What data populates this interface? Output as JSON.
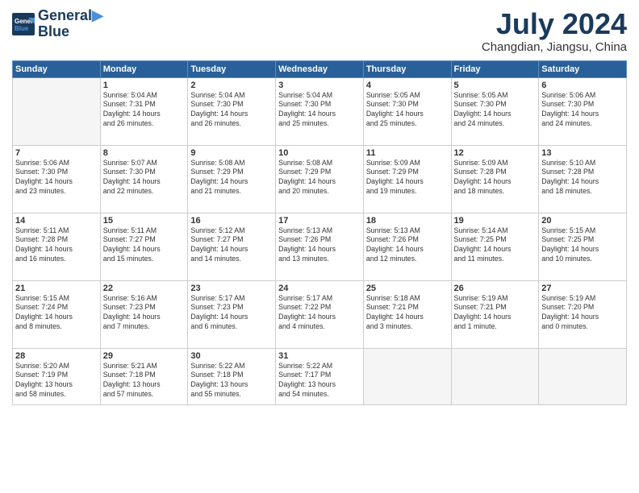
{
  "header": {
    "logo_line1": "General",
    "logo_line2": "Blue",
    "month_year": "July 2024",
    "location": "Changdian, Jiangsu, China"
  },
  "weekdays": [
    "Sunday",
    "Monday",
    "Tuesday",
    "Wednesday",
    "Thursday",
    "Friday",
    "Saturday"
  ],
  "weeks": [
    [
      {
        "day": "",
        "info": ""
      },
      {
        "day": "1",
        "info": "Sunrise: 5:04 AM\nSunset: 7:31 PM\nDaylight: 14 hours\nand 26 minutes."
      },
      {
        "day": "2",
        "info": "Sunrise: 5:04 AM\nSunset: 7:30 PM\nDaylight: 14 hours\nand 26 minutes."
      },
      {
        "day": "3",
        "info": "Sunrise: 5:04 AM\nSunset: 7:30 PM\nDaylight: 14 hours\nand 25 minutes."
      },
      {
        "day": "4",
        "info": "Sunrise: 5:05 AM\nSunset: 7:30 PM\nDaylight: 14 hours\nand 25 minutes."
      },
      {
        "day": "5",
        "info": "Sunrise: 5:05 AM\nSunset: 7:30 PM\nDaylight: 14 hours\nand 24 minutes."
      },
      {
        "day": "6",
        "info": "Sunrise: 5:06 AM\nSunset: 7:30 PM\nDaylight: 14 hours\nand 24 minutes."
      }
    ],
    [
      {
        "day": "7",
        "info": "Sunrise: 5:06 AM\nSunset: 7:30 PM\nDaylight: 14 hours\nand 23 minutes."
      },
      {
        "day": "8",
        "info": "Sunrise: 5:07 AM\nSunset: 7:30 PM\nDaylight: 14 hours\nand 22 minutes."
      },
      {
        "day": "9",
        "info": "Sunrise: 5:08 AM\nSunset: 7:29 PM\nDaylight: 14 hours\nand 21 minutes."
      },
      {
        "day": "10",
        "info": "Sunrise: 5:08 AM\nSunset: 7:29 PM\nDaylight: 14 hours\nand 20 minutes."
      },
      {
        "day": "11",
        "info": "Sunrise: 5:09 AM\nSunset: 7:29 PM\nDaylight: 14 hours\nand 19 minutes."
      },
      {
        "day": "12",
        "info": "Sunrise: 5:09 AM\nSunset: 7:28 PM\nDaylight: 14 hours\nand 18 minutes."
      },
      {
        "day": "13",
        "info": "Sunrise: 5:10 AM\nSunset: 7:28 PM\nDaylight: 14 hours\nand 18 minutes."
      }
    ],
    [
      {
        "day": "14",
        "info": "Sunrise: 5:11 AM\nSunset: 7:28 PM\nDaylight: 14 hours\nand 16 minutes."
      },
      {
        "day": "15",
        "info": "Sunrise: 5:11 AM\nSunset: 7:27 PM\nDaylight: 14 hours\nand 15 minutes."
      },
      {
        "day": "16",
        "info": "Sunrise: 5:12 AM\nSunset: 7:27 PM\nDaylight: 14 hours\nand 14 minutes."
      },
      {
        "day": "17",
        "info": "Sunrise: 5:13 AM\nSunset: 7:26 PM\nDaylight: 14 hours\nand 13 minutes."
      },
      {
        "day": "18",
        "info": "Sunrise: 5:13 AM\nSunset: 7:26 PM\nDaylight: 14 hours\nand 12 minutes."
      },
      {
        "day": "19",
        "info": "Sunrise: 5:14 AM\nSunset: 7:25 PM\nDaylight: 14 hours\nand 11 minutes."
      },
      {
        "day": "20",
        "info": "Sunrise: 5:15 AM\nSunset: 7:25 PM\nDaylight: 14 hours\nand 10 minutes."
      }
    ],
    [
      {
        "day": "21",
        "info": "Sunrise: 5:15 AM\nSunset: 7:24 PM\nDaylight: 14 hours\nand 8 minutes."
      },
      {
        "day": "22",
        "info": "Sunrise: 5:16 AM\nSunset: 7:23 PM\nDaylight: 14 hours\nand 7 minutes."
      },
      {
        "day": "23",
        "info": "Sunrise: 5:17 AM\nSunset: 7:23 PM\nDaylight: 14 hours\nand 6 minutes."
      },
      {
        "day": "24",
        "info": "Sunrise: 5:17 AM\nSunset: 7:22 PM\nDaylight: 14 hours\nand 4 minutes."
      },
      {
        "day": "25",
        "info": "Sunrise: 5:18 AM\nSunset: 7:21 PM\nDaylight: 14 hours\nand 3 minutes."
      },
      {
        "day": "26",
        "info": "Sunrise: 5:19 AM\nSunset: 7:21 PM\nDaylight: 14 hours\nand 1 minute."
      },
      {
        "day": "27",
        "info": "Sunrise: 5:19 AM\nSunset: 7:20 PM\nDaylight: 14 hours\nand 0 minutes."
      }
    ],
    [
      {
        "day": "28",
        "info": "Sunrise: 5:20 AM\nSunset: 7:19 PM\nDaylight: 13 hours\nand 58 minutes."
      },
      {
        "day": "29",
        "info": "Sunrise: 5:21 AM\nSunset: 7:18 PM\nDaylight: 13 hours\nand 57 minutes."
      },
      {
        "day": "30",
        "info": "Sunrise: 5:22 AM\nSunset: 7:18 PM\nDaylight: 13 hours\nand 55 minutes."
      },
      {
        "day": "31",
        "info": "Sunrise: 5:22 AM\nSunset: 7:17 PM\nDaylight: 13 hours\nand 54 minutes."
      },
      {
        "day": "",
        "info": ""
      },
      {
        "day": "",
        "info": ""
      },
      {
        "day": "",
        "info": ""
      }
    ]
  ]
}
